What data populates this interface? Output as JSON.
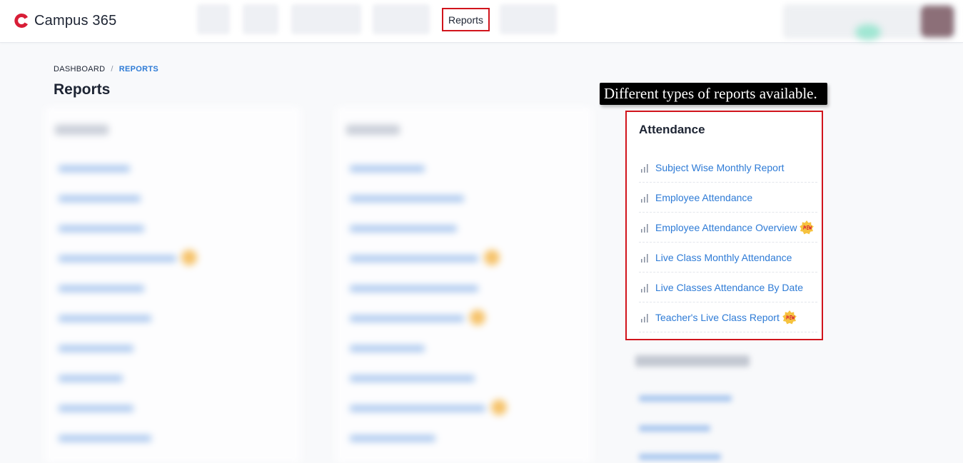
{
  "app": {
    "name": "Campus 365"
  },
  "nav": {
    "active_label": "Reports"
  },
  "breadcrumb": {
    "home": "DASHBOARD",
    "separator": "/",
    "current": "REPORTS"
  },
  "page": {
    "title": "Reports"
  },
  "annotation": {
    "text": "Different types of reports available."
  },
  "attendance": {
    "title": "Attendance",
    "items": [
      {
        "label": "Subject Wise Monthly Report",
        "is_new": false
      },
      {
        "label": "Employee Attendance",
        "is_new": false
      },
      {
        "label": "Employee Attendance Overview",
        "is_new": true
      },
      {
        "label": "Live Class Monthly Attendance",
        "is_new": false
      },
      {
        "label": "Live Classes Attendance By Date",
        "is_new": false
      },
      {
        "label": "Teacher's Live Class Report",
        "is_new": true
      }
    ],
    "item_icon": "bar-chart-icon",
    "badge_icon": "new-badge-icon"
  },
  "colors": {
    "brand": "#d81e37",
    "link": "#2e7bd6",
    "highlight_border": "#d1141c",
    "badge": "#f6c23e"
  }
}
